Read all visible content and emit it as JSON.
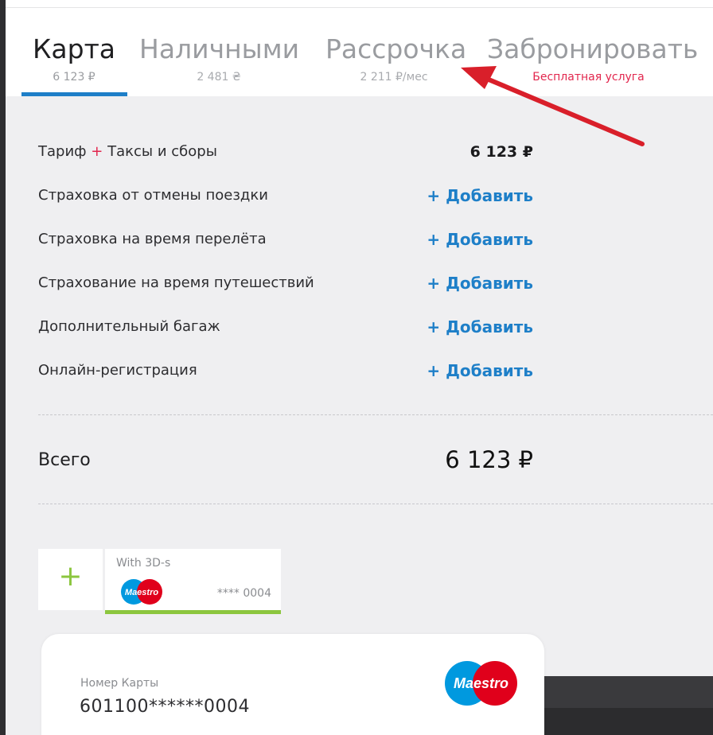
{
  "tabs": [
    {
      "label": "Карта",
      "sub": "6 123 ₽"
    },
    {
      "label": "Наличными",
      "sub": "2 481 ₴"
    },
    {
      "label": "Рассрочка",
      "sub": "2 211 ₽/мес"
    },
    {
      "label": "Забронировать",
      "sub": "Бесплатная услуга"
    }
  ],
  "price_rows": {
    "tariff": {
      "label_a": "Тариф",
      "plus": "+",
      "label_b": "Таксы и сборы",
      "value": "6 123 ₽"
    },
    "items": [
      {
        "label": "Страховка от отмены поездки",
        "action": "+ Добавить"
      },
      {
        "label": "Страховка на время перелёта",
        "action": "+ Добавить"
      },
      {
        "label": "Страхование на время путешествий",
        "action": "+ Добавить"
      },
      {
        "label": "Дополнительный багаж",
        "action": "+ Добавить"
      },
      {
        "label": "Онлайн-регистрация",
        "action": "+ Добавить"
      }
    ]
  },
  "total": {
    "label": "Всего",
    "value": "6 123 ₽"
  },
  "saved_cards": {
    "add_symbol": "+",
    "card": {
      "label": "With 3D-s",
      "number": "**** 0004",
      "brand": "Maestro"
    }
  },
  "card_form": {
    "number_label": "Номер Карты",
    "number_value": "601100******0004",
    "brand": "Maestro"
  },
  "colors": {
    "accent": "#1e7fc8",
    "red": "#e2264d",
    "green": "#8cc63f",
    "maestro_blue": "#0099df",
    "maestro_red": "#e0001b"
  }
}
